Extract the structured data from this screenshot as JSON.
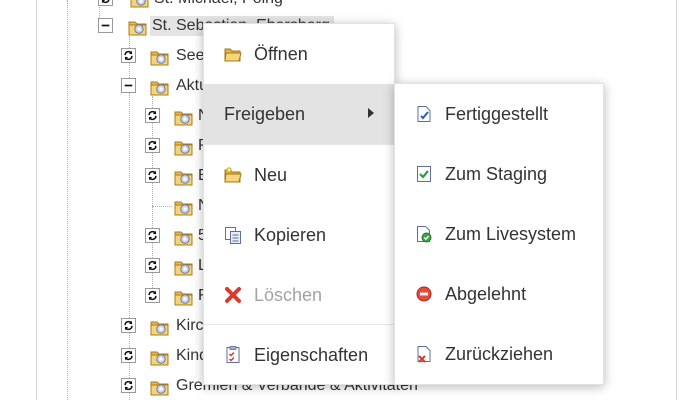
{
  "tree": {
    "top_item": "St. Michael, Poing",
    "selected_item": "St. Sebastian, Ebersberg",
    "row_seelsorge": "See",
    "row_aktuelles": "Aktu",
    "child_1": "N",
    "child_2": "P",
    "child_3": "E",
    "child_4": "N",
    "child_5": "5",
    "child_6": "L",
    "child_7": "F",
    "row_kirchen": "Kirc",
    "row_kinder": "Kind",
    "row_gremien": "Gremien & Verbände & Aktivitäten"
  },
  "context_menu": {
    "open": "Öffnen",
    "publish": "Freigeben",
    "new": "Neu",
    "copy": "Kopieren",
    "delete": "Löschen",
    "properties": "Eigenschaften"
  },
  "submenu": {
    "finished": "Fertiggestellt",
    "staging": "Zum Staging",
    "live": "Zum Livesystem",
    "rejected": "Abgelehnt",
    "withdraw": "Zurückziehen"
  },
  "icons": {
    "folder": "folder-icon",
    "refresh": "refresh-icon",
    "collapse": "minus-icon",
    "disabled_delete": "delete-icon"
  },
  "colors": {
    "menu_highlight": "#e3e3e3",
    "selected_bg": "#e4e4e4",
    "disabled_text": "#a3a3a3",
    "delete_red": "#d93a2b"
  }
}
